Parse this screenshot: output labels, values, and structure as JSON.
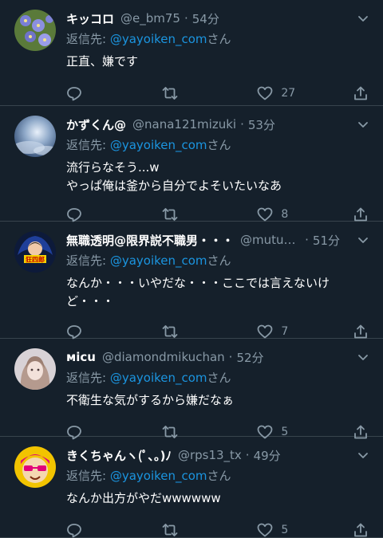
{
  "reply_prefix": "返信先: ",
  "reply_suffix": "さん",
  "dot": "·",
  "tweets": [
    {
      "name": "キッコロ",
      "handle": "@e_bm75",
      "time": "54分",
      "reply_to": "@yayoiken_com",
      "lines": [
        "正直、嫌です"
      ],
      "like_count": "27",
      "avatar_icon": "flower-avatar"
    },
    {
      "name": "かずくん@",
      "handle": "@nana121mizuki",
      "time": "53分",
      "reply_to": "@yayoiken_com",
      "lines": [
        "流行らなそう...w",
        "やっぱ俺は釜から自分でよそいたいなあ"
      ],
      "like_count": "8",
      "avatar_icon": "sky-avatar"
    },
    {
      "name": "無職透明@限界説不職男・・・",
      "handle": "@mutuk...",
      "time": "51分",
      "reply_to": "@yayoiken_com",
      "lines": [
        "なんか・・・いやだな・・・ここでは言えないけ",
        "ど・・・"
      ],
      "like_count": "7",
      "avatar_icon": "anime-emblem-avatar"
    },
    {
      "name": "мicu",
      "handle": "@diamondmikuchan",
      "time": "52分",
      "reply_to": "@yayoiken_com",
      "lines": [
        "不衛生な気がするから嫌だなぁ"
      ],
      "like_count": "5",
      "avatar_icon": "portrait-avatar"
    },
    {
      "name": "きくちゃんヽ(ﾟ､｡)ﾉ",
      "handle": "@rps13_tx",
      "time": "49分",
      "reply_to": "@yayoiken_com",
      "lines": [
        "なんか出方がやだwwwwww"
      ],
      "like_count": "5",
      "avatar_icon": "cartoon-sunglasses-avatar"
    }
  ],
  "colors": {
    "background": "#15202b",
    "divider": "#38444d",
    "secondary_text": "#8899a6",
    "mention": "#1b95e0"
  }
}
